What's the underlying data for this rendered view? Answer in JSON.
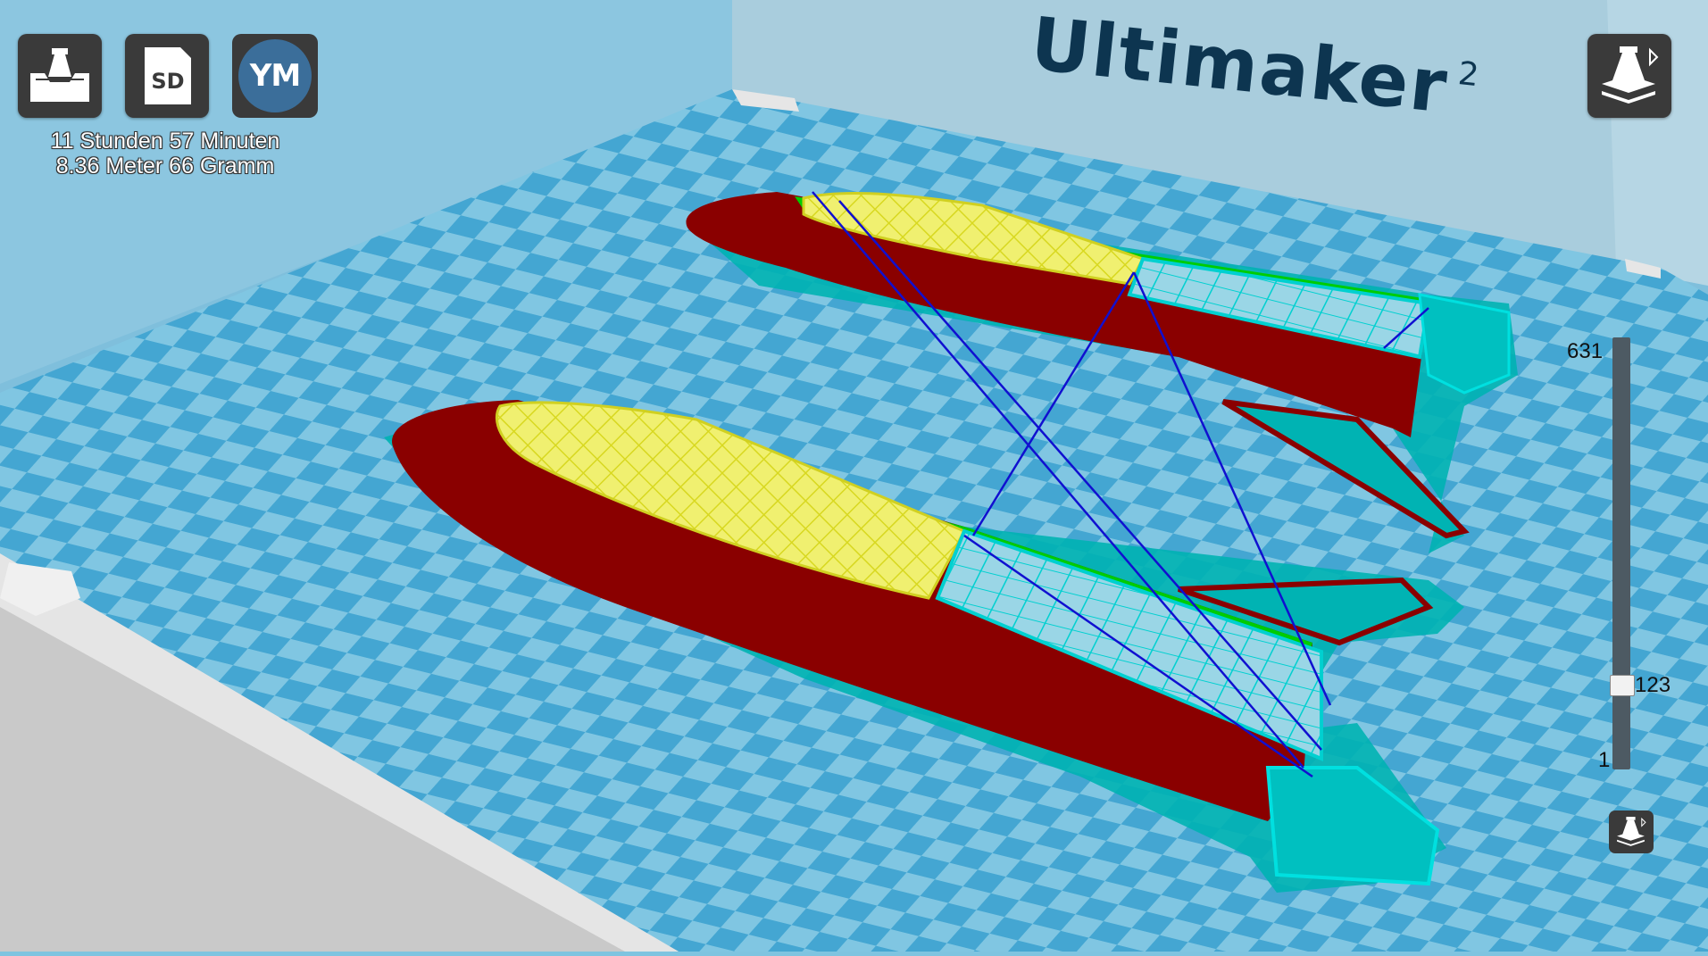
{
  "toolbar": {
    "load_icon": "load-model-icon",
    "sd_icon": "sd-card-icon",
    "sd_label": "SD",
    "ym_label": "YM"
  },
  "print_info": {
    "time": "11 Stunden 57 Minuten",
    "material": "8.36 Meter 66 Gramm"
  },
  "brand": {
    "name": "Ultimaker",
    "version": "2"
  },
  "layer_slider": {
    "max": "631",
    "current": "123",
    "min": "1",
    "current_fraction": 0.195
  },
  "view_mode": {
    "icon": "layer-view-icon"
  },
  "colors": {
    "bed_light": "#7fc4e0",
    "bed_dark": "#3f9fcc",
    "wall_outer": "#8a0000",
    "wall_inner": "#00e000",
    "infill": "#e8e840",
    "support": "#00c8c8",
    "travel": "#1010d0",
    "toolbar_bg": "#3a3a3a"
  }
}
